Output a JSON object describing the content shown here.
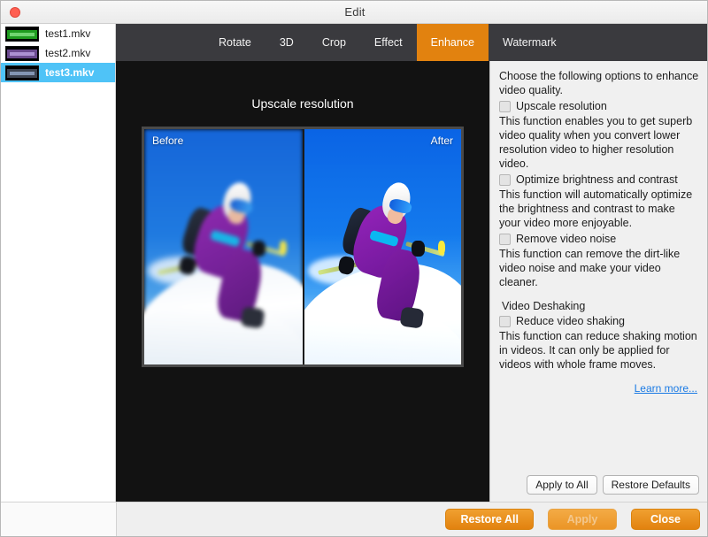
{
  "window": {
    "title": "Edit",
    "close_icon": "close-dot-icon"
  },
  "sidebar": {
    "files": [
      {
        "name": "test1.mkv",
        "thumb_color": "#1f9c1f",
        "thumb_color2": "#7fe07f",
        "selected": false
      },
      {
        "name": "test2.mkv",
        "thumb_color": "#6b4a8f",
        "thumb_color2": "#b79ede",
        "selected": false
      },
      {
        "name": "test3.mkv",
        "thumb_color": "#3d4452",
        "thumb_color2": "#8fa3c4",
        "selected": true
      }
    ]
  },
  "tabs": {
    "items": [
      {
        "label": "Rotate",
        "active": false
      },
      {
        "label": "3D",
        "active": false
      },
      {
        "label": "Crop",
        "active": false
      },
      {
        "label": "Effect",
        "active": false
      },
      {
        "label": "Enhance",
        "active": true
      },
      {
        "label": "Watermark",
        "active": false
      }
    ],
    "active_color": "#e2820f",
    "bar_color": "#3a3a3e"
  },
  "preview": {
    "title": "Upscale resolution",
    "before_label": "Before",
    "after_label": "After",
    "background": "#121212"
  },
  "options": {
    "intro": "Choose the following options to enhance video quality.",
    "items": [
      {
        "label": "Upscale resolution",
        "checked": false,
        "description": "This function enables you to get superb video quality when you convert lower resolution video to higher resolution video."
      },
      {
        "label": "Optimize brightness and contrast",
        "checked": false,
        "description": "This function will automatically optimize the brightness and contrast to make your video more enjoyable."
      },
      {
        "label": "Remove video noise",
        "checked": false,
        "description": "This function can remove the dirt-like video noise and make your video cleaner."
      }
    ],
    "section_heading": "Video Deshaking",
    "deshake": {
      "label": "Reduce video shaking",
      "checked": false,
      "description": "This function can reduce shaking motion in videos. It can only be applied for videos with whole frame moves."
    },
    "learn_more": "Learn more...",
    "learn_more_color": "#1a7ae4",
    "apply_to_all": "Apply to All",
    "restore_defaults": "Restore Defaults"
  },
  "footer": {
    "restore_all": "Restore All",
    "apply": "Apply",
    "apply_disabled": true,
    "close": "Close",
    "button_color": "#e2820f"
  }
}
